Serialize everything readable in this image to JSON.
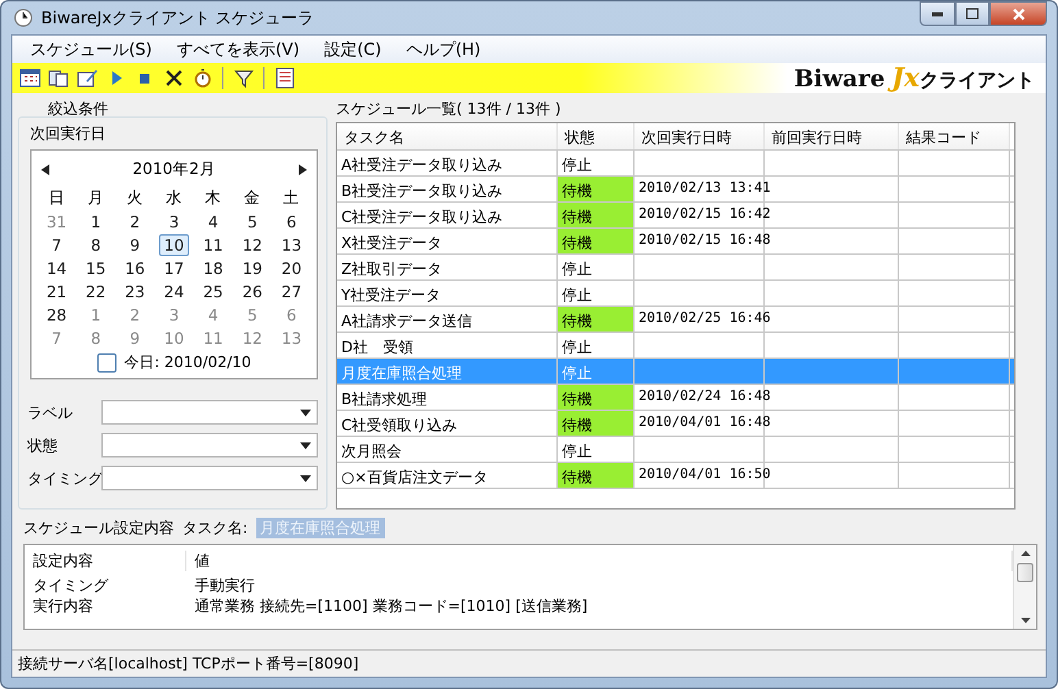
{
  "window": {
    "title": "BiwareJxクライアント スケジューラ"
  },
  "menu": [
    {
      "label": "スケジュール(S)"
    },
    {
      "label": "すべてを表示(V)"
    },
    {
      "label": "設定(C)"
    },
    {
      "label": "ヘルプ(H)"
    }
  ],
  "logo": {
    "brand": "Biware",
    "accent": "Jx",
    "product": "クライアント"
  },
  "filter": {
    "title": "絞込条件",
    "date_label": "次回実行日",
    "calendar": {
      "month": "2010年2月",
      "weekdays": [
        "日",
        "月",
        "火",
        "水",
        "木",
        "金",
        "土"
      ],
      "weeks": [
        [
          {
            "day": "31",
            "other": true,
            "selected": false
          },
          {
            "day": "1",
            "other": false,
            "selected": false
          },
          {
            "day": "2",
            "other": false,
            "selected": false
          },
          {
            "day": "3",
            "other": false,
            "selected": false
          },
          {
            "day": "4",
            "other": false,
            "selected": false
          },
          {
            "day": "5",
            "other": false,
            "selected": false
          },
          {
            "day": "6",
            "other": false,
            "selected": false
          }
        ],
        [
          {
            "day": "7",
            "other": false,
            "selected": false
          },
          {
            "day": "8",
            "other": false,
            "selected": false
          },
          {
            "day": "9",
            "other": false,
            "selected": false
          },
          {
            "day": "10",
            "other": false,
            "selected": true
          },
          {
            "day": "11",
            "other": false,
            "selected": false
          },
          {
            "day": "12",
            "other": false,
            "selected": false
          },
          {
            "day": "13",
            "other": false,
            "selected": false
          }
        ],
        [
          {
            "day": "14",
            "other": false,
            "selected": false
          },
          {
            "day": "15",
            "other": false,
            "selected": false
          },
          {
            "day": "16",
            "other": false,
            "selected": false
          },
          {
            "day": "17",
            "other": false,
            "selected": false
          },
          {
            "day": "18",
            "other": false,
            "selected": false
          },
          {
            "day": "19",
            "other": false,
            "selected": false
          },
          {
            "day": "20",
            "other": false,
            "selected": false
          }
        ],
        [
          {
            "day": "21",
            "other": false,
            "selected": false
          },
          {
            "day": "22",
            "other": false,
            "selected": false
          },
          {
            "day": "23",
            "other": false,
            "selected": false
          },
          {
            "day": "24",
            "other": false,
            "selected": false
          },
          {
            "day": "25",
            "other": false,
            "selected": false
          },
          {
            "day": "26",
            "other": false,
            "selected": false
          },
          {
            "day": "27",
            "other": false,
            "selected": false
          }
        ],
        [
          {
            "day": "28",
            "other": false,
            "selected": false
          },
          {
            "day": "1",
            "other": true,
            "selected": false
          },
          {
            "day": "2",
            "other": true,
            "selected": false
          },
          {
            "day": "3",
            "other": true,
            "selected": false
          },
          {
            "day": "4",
            "other": true,
            "selected": false
          },
          {
            "day": "5",
            "other": true,
            "selected": false
          },
          {
            "day": "6",
            "other": true,
            "selected": false
          }
        ],
        [
          {
            "day": "7",
            "other": true,
            "selected": false
          },
          {
            "day": "8",
            "other": true,
            "selected": false
          },
          {
            "day": "9",
            "other": true,
            "selected": false
          },
          {
            "day": "10",
            "other": true,
            "selected": false
          },
          {
            "day": "11",
            "other": true,
            "selected": false
          },
          {
            "day": "12",
            "other": true,
            "selected": false
          },
          {
            "day": "13",
            "other": true,
            "selected": false
          }
        ]
      ],
      "today": "今日: 2010/02/10"
    },
    "fields": [
      {
        "label": "ラベル"
      },
      {
        "label": "状態"
      },
      {
        "label": "タイミング"
      }
    ]
  },
  "schedule": {
    "title": "スケジュール一覧( 13件 / 13件 )",
    "columns": [
      "タスク名",
      "状態",
      "次回実行日時",
      "前回実行日時",
      "結果コード"
    ],
    "rows": [
      {
        "name": "A社受注データ取り込み",
        "status": "停止",
        "kind": "stopped",
        "selected": false
      },
      {
        "name": "B社受注データ取り込み",
        "status": "待機",
        "kind": "waiting",
        "next": "2010/02/13 13:41",
        "selected": false
      },
      {
        "name": "C社受注データ取り込み",
        "status": "待機",
        "kind": "waiting",
        "next": "2010/02/15 16:42",
        "selected": false
      },
      {
        "name": "X社受注データ",
        "status": "待機",
        "kind": "waiting",
        "next": "2010/02/15 16:48",
        "selected": false
      },
      {
        "name": "Z社取引データ",
        "status": "停止",
        "kind": "stopped",
        "selected": false
      },
      {
        "name": "Y社受注データ",
        "status": "停止",
        "kind": "stopped",
        "selected": false
      },
      {
        "name": "A社請求データ送信",
        "status": "待機",
        "kind": "waiting",
        "next": "2010/02/25 16:46",
        "selected": false
      },
      {
        "name": "D社　受領",
        "status": "停止",
        "kind": "stopped",
        "selected": false
      },
      {
        "name": "月度在庫照合処理",
        "status": "停止",
        "kind": "stopped",
        "selected": true
      },
      {
        "name": "B社請求処理",
        "status": "待機",
        "kind": "waiting",
        "next": "2010/02/24 16:48",
        "selected": false
      },
      {
        "name": "C社受領取り込み",
        "status": "待機",
        "kind": "waiting",
        "next": "2010/04/01 16:48",
        "selected": false
      },
      {
        "name": "次月照会",
        "status": "停止",
        "kind": "stopped",
        "selected": false
      },
      {
        "name": "○×百貨店注文データ",
        "status": "待機",
        "kind": "waiting",
        "next": "2010/04/01 16:50",
        "selected": false
      }
    ]
  },
  "details": {
    "title": "スケジュール設定内容",
    "task_label": "タスク名:",
    "task_value": "月度在庫照合処理",
    "columns": [
      "設定内容",
      "値"
    ],
    "rows": [
      {
        "setting": "タイミング",
        "value": "手動実行"
      },
      {
        "setting": "実行内容",
        "value": "通常業務 接続先=[1100] 業務コード=[1010] [送信業務]"
      }
    ]
  },
  "status_bar": "接続サーバ名[localhost] TCPポート番号=[8090]"
}
